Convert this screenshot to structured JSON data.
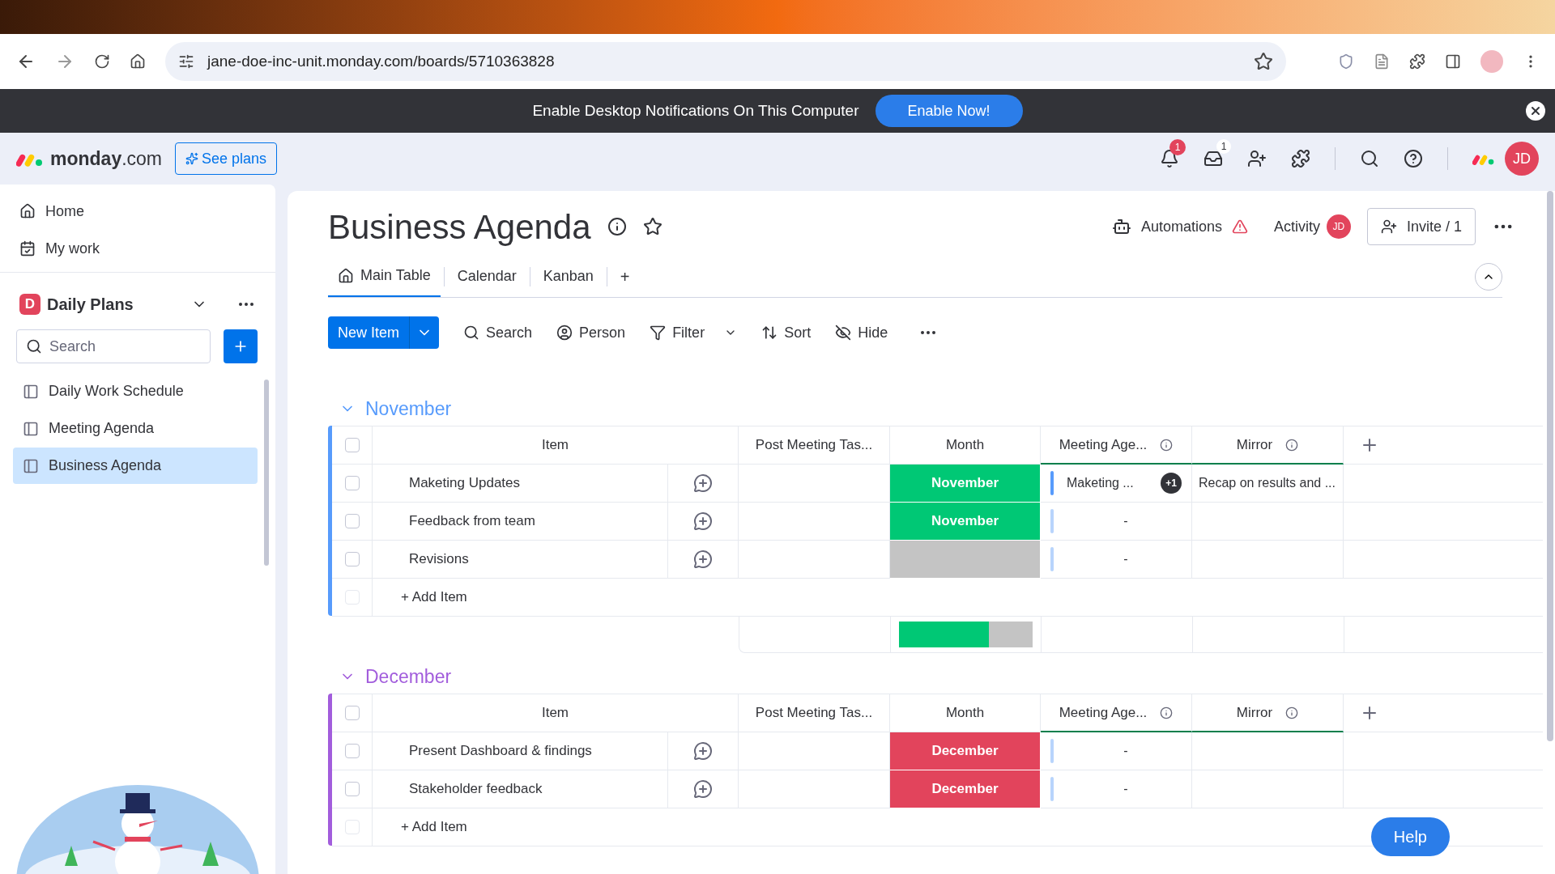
{
  "browser": {
    "url": "jane-doe-inc-unit.monday.com/boards/5710363828"
  },
  "notification": {
    "text": "Enable Desktop Notifications On This Computer",
    "button": "Enable Now!"
  },
  "header": {
    "logo": "**monday**.com",
    "see_plans": "See plans",
    "bell_badge": "1",
    "inbox_badge": "1",
    "avatar": "JD"
  },
  "sidebar": {
    "nav": [
      {
        "label": "Home",
        "kind": "home"
      },
      {
        "label": "My work",
        "kind": "work"
      }
    ],
    "workspace": {
      "badge": "D",
      "name": "Daily Plans"
    },
    "search": {
      "placeholder": "Search"
    },
    "boards": [
      {
        "label": "Daily Work Schedule",
        "selected": false
      },
      {
        "label": "Meeting Agenda",
        "selected": false
      },
      {
        "label": "Business Agenda",
        "selected": true
      }
    ]
  },
  "board": {
    "title": "Business Agenda",
    "automations": "Automations",
    "activity": "Activity",
    "activity_avatar": "JD",
    "invite": "Invite / 1",
    "tabs": [
      {
        "label": "Main Table",
        "selected": true,
        "kind": "home"
      },
      {
        "label": "Calendar",
        "selected": false,
        "kind": "plain"
      },
      {
        "label": "Kanban",
        "selected": false,
        "kind": "plain"
      }
    ],
    "add_tab": "+",
    "new_item": "New Item",
    "toolbar": [
      {
        "label": "Search",
        "kind": "search"
      },
      {
        "label": "Person",
        "kind": "person"
      },
      {
        "label": "Filter",
        "kind": "filter"
      },
      {
        "label": "Sort",
        "kind": "sort"
      },
      {
        "label": "Hide",
        "kind": "hide"
      }
    ]
  },
  "groups": [
    {
      "name": "November",
      "color": "#579bfc",
      "all_checked": false,
      "add_item_checked": false,
      "columns": [
        "Item",
        "Post Meeting Tas...",
        "Month",
        "Meeting Age...",
        "Mirror"
      ],
      "rows": [
        {
          "checked": false,
          "item": "Maketing Updates",
          "month": "November",
          "color": "#00c875",
          "agenda": "Maketing ...",
          "agenda_extra": "+1",
          "agenda_filled": true,
          "mirror": "Recap on results and ..."
        },
        {
          "checked": false,
          "item": "Feedback from team",
          "month": "November",
          "color": "#00c875",
          "agenda": "-",
          "agenda_filled": false
        },
        {
          "checked": false,
          "item": "Revisions",
          "color": "#c4c4c4",
          "agenda": "-",
          "agenda_filled": false
        }
      ],
      "add_item": "+ Add Item",
      "summary": {
        "level": 0.67
      }
    },
    {
      "name": "December",
      "color": "#a25ddc",
      "all_checked": false,
      "add_item_checked": false,
      "columns": [
        "Item",
        "Post Meeting Tas...",
        "Month",
        "Meeting Age...",
        "Mirror"
      ],
      "rows": [
        {
          "checked": false,
          "item": "Present Dashboard & findings",
          "month": "December",
          "color": "#e2445c",
          "agenda": "-",
          "agenda_filled": false
        },
        {
          "checked": false,
          "item": "Stakeholder feedback",
          "month": "December",
          "color": "#e2445c",
          "agenda": "-",
          "agenda_filled": false
        }
      ],
      "add_item": "+ Add Item"
    }
  ],
  "help": "Help"
}
